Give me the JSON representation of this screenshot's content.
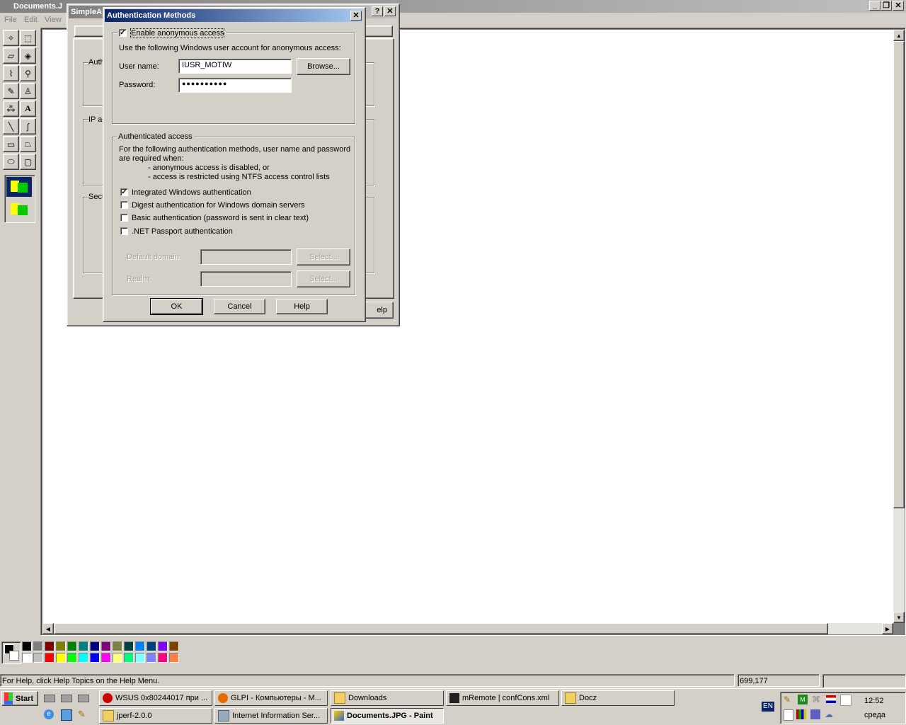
{
  "paint": {
    "title": "Documents.J",
    "menu": [
      "File",
      "Edit",
      "View"
    ],
    "status_text": "For Help, click Help Topics on the Help Menu.",
    "coords": "699,177"
  },
  "bg_dialog": {
    "title": "SimpleA",
    "groups": [
      "Auth",
      "IP a",
      "Secu"
    ],
    "help_tail": "elp"
  },
  "dialog": {
    "title": "Authentication Methods",
    "anon_checkbox": "Enable anonymous access",
    "anon_desc": "Use the following Windows user account for anonymous access:",
    "username_label": "User name:",
    "username_value": "IUSR_MOTIW",
    "password_label": "Password:",
    "password_value": "●●●●●●●●●●",
    "browse_label": "Browse...",
    "auth_group_title": "Authenticated access",
    "auth_desc1": "For the following authentication methods, user name and password",
    "auth_desc2": "are required when:",
    "auth_bullet1": "- anonymous access is disabled, or",
    "auth_bullet2": "- access is restricted using NTFS access control lists",
    "methods": [
      {
        "label": "Integrated Windows authentication",
        "checked": true
      },
      {
        "label": "Digest authentication for Windows domain servers",
        "checked": false
      },
      {
        "label": "Basic authentication (password is sent in clear text)",
        "checked": false
      },
      {
        "label": ".NET Passport authentication",
        "checked": false
      }
    ],
    "default_domain_label": "Default domain:",
    "realm_label": "Realm:",
    "select_label": "Select...",
    "ok_label": "OK",
    "cancel_label": "Cancel",
    "help_label": "Help"
  },
  "palette": {
    "row1": [
      "#000000",
      "#808080",
      "#800000",
      "#808000",
      "#008000",
      "#008080",
      "#000080",
      "#800080",
      "#808040",
      "#004040",
      "#0080ff",
      "#004080",
      "#8000ff",
      "#804000"
    ],
    "row2": [
      "#ffffff",
      "#c0c0c0",
      "#ff0000",
      "#ffff00",
      "#00ff00",
      "#00ffff",
      "#0000ff",
      "#ff00ff",
      "#ffff80",
      "#00ff80",
      "#80ffff",
      "#8080ff",
      "#ff0080",
      "#ff8040"
    ]
  },
  "taskbar": {
    "start_label": "Start",
    "tasks_row1": [
      "WSUS 0x80244017 при ...",
      "GLPI - Компьютеры - M...",
      "Downloads",
      "mRemote | confCons.xml",
      "Docz"
    ],
    "tasks_row2": [
      "jperf-2.0.0",
      "Internet Information Ser...",
      "Documents.JPG - Paint"
    ],
    "lang": "EN",
    "time": "12:52",
    "day": "среда"
  }
}
